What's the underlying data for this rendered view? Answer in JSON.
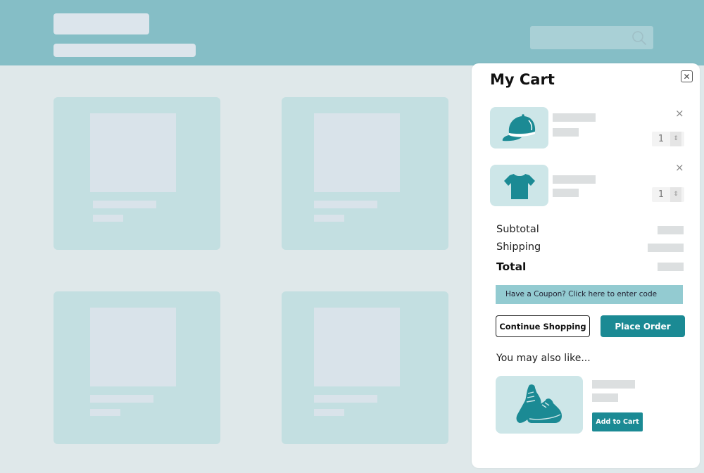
{
  "colors": {
    "header_bg": "#85bec6",
    "page_bg": "#dfe8ea",
    "card_bg": "#c3dfe1",
    "accent": "#1b8a94",
    "coupon_bg": "#93cbd1"
  },
  "header": {
    "search": {
      "placeholder": "",
      "icon": "search-icon"
    }
  },
  "product_grid": {
    "cards": [
      {
        "name": "product-card-1"
      },
      {
        "name": "product-card-2"
      },
      {
        "name": "product-card-3"
      },
      {
        "name": "product-card-4"
      }
    ]
  },
  "cart": {
    "title": "My Cart",
    "close_icon": "close-icon",
    "items": [
      {
        "icon": "cap-icon",
        "quantity": "1",
        "remove_glyph": "×",
        "spin_glyph": "⌃⌄"
      },
      {
        "icon": "tshirt-icon",
        "quantity": "1",
        "remove_glyph": "×",
        "spin_glyph": "⌃⌄"
      }
    ],
    "summary": {
      "subtotal_label": "Subtotal",
      "shipping_label": "Shipping",
      "total_label": "Total"
    },
    "coupon_text": "Have a Coupon? Click here to enter code",
    "continue_label": "Continue Shopping",
    "place_order_label": "Place Order",
    "recommend": {
      "heading": "You may also like...",
      "icon": "sneakers-icon",
      "add_label": "Add to Cart"
    }
  }
}
